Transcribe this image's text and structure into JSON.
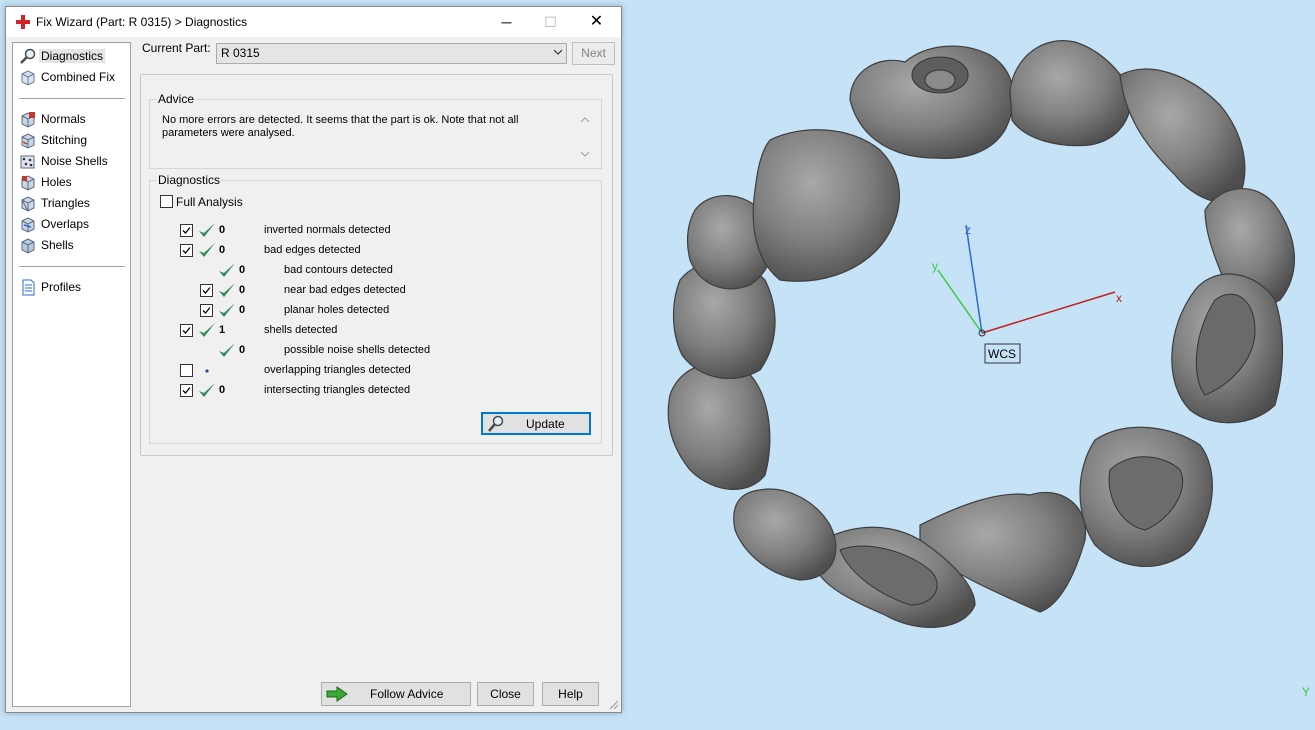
{
  "window": {
    "title": "Fix Wizard (Part: R 0315) > Diagnostics",
    "minimize_glyph": "─",
    "maximize_glyph": "☐",
    "close_glyph": "✕"
  },
  "nav": {
    "items": [
      {
        "label": "Diagnostics",
        "icon": "magnifier-icon",
        "selected": true
      },
      {
        "label": "Combined Fix",
        "icon": "cube-icon"
      },
      {
        "label": "Normals",
        "icon": "normals-cube-icon"
      },
      {
        "label": "Stitching",
        "icon": "stitching-cube-icon"
      },
      {
        "label": "Noise Shells",
        "icon": "noise-shells-icon"
      },
      {
        "label": "Holes",
        "icon": "holes-cube-icon"
      },
      {
        "label": "Triangles",
        "icon": "triangles-cube-icon"
      },
      {
        "label": "Overlaps",
        "icon": "overlaps-cube-icon"
      },
      {
        "label": "Shells",
        "icon": "shells-cube-icon"
      },
      {
        "label": "Profiles",
        "icon": "document-icon"
      }
    ]
  },
  "current_part": {
    "label": "Current Part:",
    "value": "R 0315",
    "next_label": "Next"
  },
  "advice": {
    "group_label": "Advice",
    "text": "No more errors are detected. It seems that the part is ok. Note that not all parameters were analysed."
  },
  "diagnostics": {
    "group_label": "Diagnostics",
    "full_analysis_label": "Full Analysis",
    "full_analysis_checked": false,
    "rows": [
      {
        "checkbox": true,
        "checked": true,
        "status": "ok",
        "count": "0",
        "text": "inverted normals detected"
      },
      {
        "checkbox": true,
        "checked": true,
        "status": "ok",
        "count": "0",
        "text": "bad edges detected"
      },
      {
        "checkbox": false,
        "checked": false,
        "status": "ok",
        "count": "0",
        "text": "bad contours detected"
      },
      {
        "checkbox": true,
        "checked": true,
        "status": "ok",
        "count": "0",
        "text": "near bad edges detected"
      },
      {
        "checkbox": true,
        "checked": true,
        "status": "ok",
        "count": "0",
        "text": "planar holes detected"
      },
      {
        "checkbox": true,
        "checked": true,
        "status": "ok",
        "count": "1",
        "text": "shells detected"
      },
      {
        "checkbox": false,
        "checked": false,
        "status": "ok",
        "count": "0",
        "text": "possible noise shells detected"
      },
      {
        "checkbox": true,
        "checked": false,
        "status": "none",
        "count": "",
        "text": "overlapping triangles detected"
      },
      {
        "checkbox": true,
        "checked": true,
        "status": "ok",
        "count": "0",
        "text": "intersecting triangles detected"
      }
    ],
    "update_label": "Update"
  },
  "footer": {
    "follow_label": "Follow Advice",
    "close_label": "Close",
    "help_label": "Help"
  },
  "viewport": {
    "background": "#c6e2f7",
    "axes": {
      "x": "x",
      "y": "y",
      "z": "z"
    },
    "wcs_label": "WCS",
    "corner_axis_label": "Y",
    "colors": {
      "x_axis": "#c0201c",
      "y_axis": "#3cc83c",
      "z_axis": "#2a6ad8",
      "model": "#7d7d7d"
    }
  }
}
